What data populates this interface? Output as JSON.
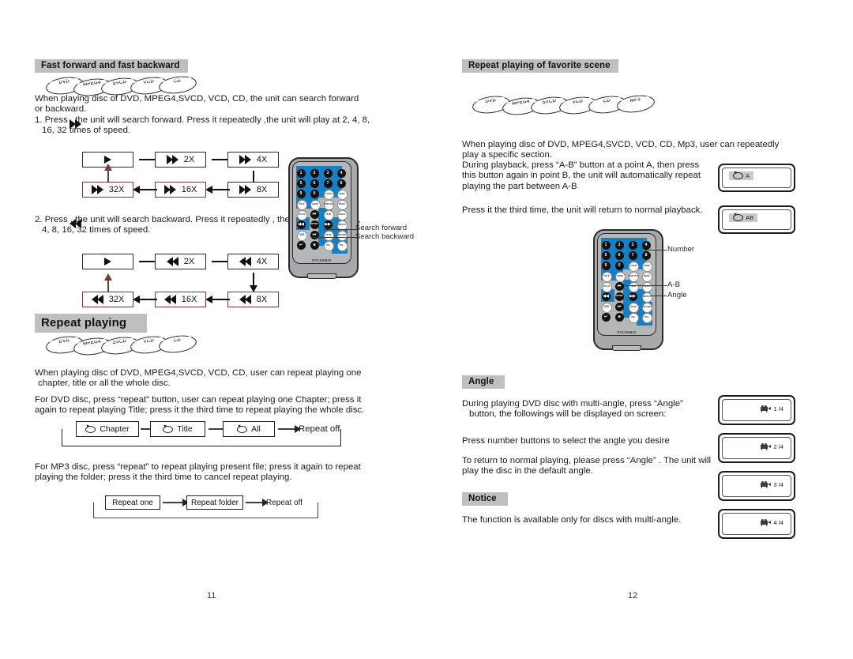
{
  "document": {
    "left_page_number": "11",
    "right_page_number": "12"
  },
  "left_page": {
    "section1": {
      "heading": "Fast forward and fast backward",
      "discs": [
        "DVD",
        "MPEG4",
        "SVCD",
        "VCD",
        "CD"
      ],
      "intro": "When playing disc of DVD, MPEG4,SVCD, VCD, CD, the unit can search forward or backward.",
      "step1": "1. Press    , the unit will search forward. Press it repeatedly ,the unit will play at 2, 4, 8, 16, 32 times of speed.",
      "step2": "2. Press    , the unit will search backward. Press it repeatedly , the unit will play at 2, 4, 8, 16, 32 times of speed.",
      "forward_flow": [
        "",
        "2X",
        "4X",
        "8X",
        "16X",
        "32X"
      ],
      "backward_flow": [
        "",
        "2X",
        "4X",
        "8X",
        "16X",
        "32X"
      ],
      "remote_callouts": [
        "Search forward",
        "Search backward"
      ]
    },
    "section2": {
      "heading": "Repeat playing",
      "discs": [
        "DVD",
        "MPEG4",
        "SVCD",
        "VCD",
        "CD"
      ],
      "para1": "When playing disc of DVD, MPEG4,SVCD, VCD, CD, user can repeat playing one chapter, title or all the whole disc.",
      "para2": "For DVD disc, press “repeat” button, user can repeat playing one Chapter; press it again to repeat playing Title; press it the third time to repeat playing the whole disc.",
      "dvd_flow": [
        "Chapter",
        "Title",
        "All",
        "Repeat off"
      ],
      "para3": "For MP3 disc, press “repeat” to repeat playing present file; press it again to repeat playing the folder; press it the third time to cancel repeat playing.",
      "mp3_flow": [
        "Repeat one",
        "Repeat folder",
        "Repeat off"
      ]
    }
  },
  "right_page": {
    "section1": {
      "heading": "Repeat playing of favorite scene",
      "discs": [
        "DVD",
        "MPEG4",
        "SVCD",
        "VCD",
        "CD",
        "MP3"
      ],
      "para1": "When playing disc of DVD, MPEG4,SVCD, VCD, CD, Mp3,  user can repeatedly play a specific section.",
      "para2": "During playback, press “A-B” button at a point A, then press this button again in  point B, the unit will automatically repeat playing the part between A-B",
      "para3": "Press it the third time, the unit will return to normal playback.",
      "osd_a": "A",
      "osd_ab": "AB",
      "remote_callouts": [
        "Number",
        "A-B",
        "Angle"
      ]
    },
    "section2": {
      "heading": "Angle",
      "para1": "During playing DVD disc with multi-angle, press “Angle” button, the followings will be displayed on screen:",
      "para2": "Press number buttons to select the angle you desire",
      "para3": "To return to normal playing, please press “Angle” . The unit will play the disc in the default angle.",
      "angles": [
        "1 /4",
        "2 /4",
        "3 /4",
        "4 /4"
      ]
    },
    "section3": {
      "heading": "Notice",
      "para1": "The function is available only for discs with multi-angle."
    }
  },
  "remote": {
    "brand": "SYLVANIA",
    "rows": [
      [
        "1",
        "2",
        "3",
        "4"
      ],
      [
        "5",
        "6",
        "7",
        "8"
      ],
      [
        "9",
        "0",
        "ZOOM",
        "MODE"
      ],
      [
        "TITLE",
        "AUDIO",
        "SUBTITLE",
        "MENU"
      ],
      [
        "SETUP",
        "⏮",
        "A-B",
        "ANGLE"
      ],
      [
        "◀◀",
        "ENTER",
        "▶▶",
        "REPEAT"
      ],
      [
        "OSD",
        "⏭",
        "MUTE",
        "RETURN"
      ],
      [
        "↩",
        "■",
        "VOL-",
        "VOL+"
      ]
    ]
  },
  "colors": {
    "heading_bg": "#bfbfbf",
    "remote_blue": "#1a7fc1",
    "remote_body": "#a7a9ac",
    "text": "#1b1b1b",
    "accent_red": "#6f3a3a"
  }
}
